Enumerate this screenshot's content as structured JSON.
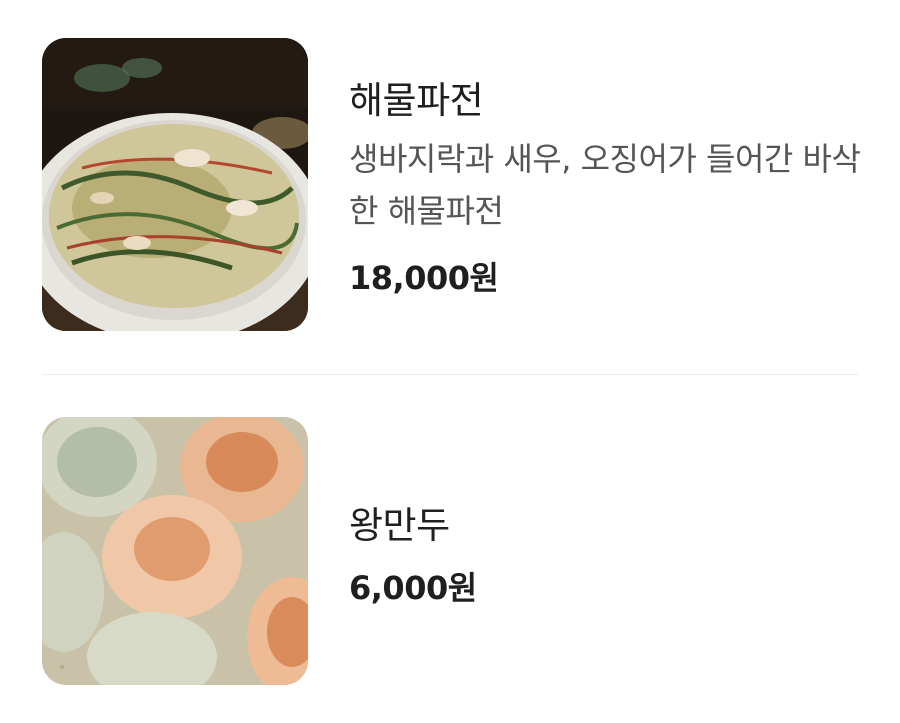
{
  "menu": {
    "items": [
      {
        "name": "해물파전",
        "description": "생바지락과 새우, 오징어가 들어간 바삭한 해물파전",
        "price": "18,000원",
        "image": "seafood-pancake-photo"
      },
      {
        "name": "왕만두",
        "price": "6,000원",
        "image": "steamed-dumplings-photo"
      }
    ]
  }
}
